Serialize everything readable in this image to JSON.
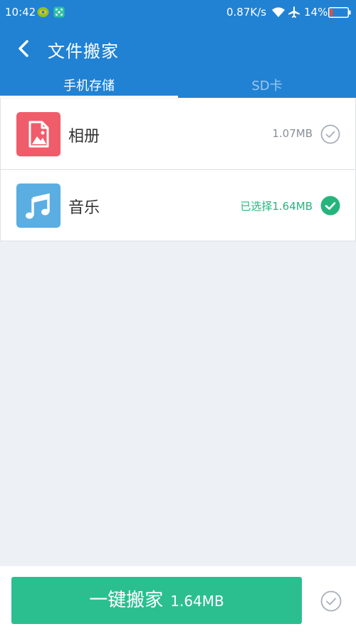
{
  "status_bar": {
    "time": "10:42",
    "net_speed": "0.87K/s",
    "battery_percent": "14%",
    "icons": [
      "notification-app-icon",
      "screenshot-icon",
      "wifi-icon",
      "airplane-icon",
      "battery-icon"
    ]
  },
  "header": {
    "title": "文件搬家",
    "back_icon": "chevron-left-icon"
  },
  "tabs": [
    {
      "label": "手机存储",
      "active": true
    },
    {
      "label": "SD卡",
      "active": false
    }
  ],
  "items": [
    {
      "label": "相册",
      "size": "1.07MB",
      "selected": false,
      "icon": "photo-album-icon",
      "icon_color": "#ef5c6a"
    },
    {
      "label": "音乐",
      "size": "已选择1.64MB",
      "selected": true,
      "icon": "music-note-icon",
      "icon_color": "#5aaee2"
    }
  ],
  "bottom": {
    "button_label": "一键搬家",
    "button_amount": "1.64MB"
  },
  "colors": {
    "primary_blue": "#2182d4",
    "accent_green": "#2bbf8f",
    "background": "#edf0f5"
  }
}
